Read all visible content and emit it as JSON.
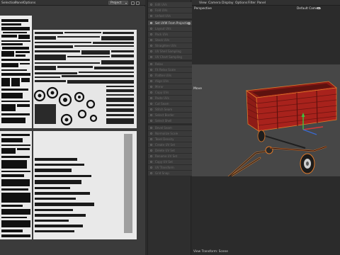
{
  "uv_editor": {
    "menus": [
      "Selection",
      "Panel",
      "Options"
    ],
    "dropdown_value": "Project"
  },
  "mid_panel": {
    "items": [
      {
        "label": "Edit UVs"
      },
      {
        "label": "Fold UVs"
      },
      {
        "label": "Unfold UVs"
      },
      {
        "label": "Set UVW From Projection",
        "active": true
      },
      {
        "label": "Layout UVs"
      },
      {
        "label": "Pack UVs"
      },
      {
        "label": "Stack UVs"
      },
      {
        "label": "Straighten UVs"
      },
      {
        "label": "UV Shell Sampling"
      },
      {
        "label": "UV Chart Sampling"
      },
      {
        "label": "Relax"
      },
      {
        "label": "Fit Relax Scale"
      },
      {
        "label": "Flatten UVs"
      },
      {
        "label": "Align UVs"
      },
      {
        "label": "Mirror"
      },
      {
        "label": "Copy UVs"
      },
      {
        "label": "Paste UVs"
      },
      {
        "label": "Cut Seam"
      },
      {
        "label": "Stitch Seam"
      },
      {
        "label": "Select Border"
      },
      {
        "label": "Select Shell"
      },
      {
        "label": "Bevel Seam"
      },
      {
        "label": "Normalize Scale"
      },
      {
        "label": "Texel Density"
      },
      {
        "label": "Create UV Set"
      },
      {
        "label": "Delete UV Set"
      },
      {
        "label": "Rename UV Set"
      },
      {
        "label": "Copy UV Set"
      },
      {
        "label": "UV Transform"
      },
      {
        "label": "Grid Snap"
      },
      {
        "label": "Pin UVs"
      },
      {
        "label": "Unpin UVs"
      },
      {
        "label": "Lock"
      },
      {
        "label": "Unlock"
      },
      {
        "label": "Snap"
      }
    ]
  },
  "viewport": {
    "menus": [
      "View",
      "Camera",
      "Display",
      "Options",
      "Filter",
      "Panel"
    ],
    "name": "Perspective",
    "camera": "Default Camera",
    "tool_label": "Move",
    "status": "View Transform: Scene"
  },
  "colors": {
    "trailer_body": "#a8221c",
    "trailer_dark": "#6e1410",
    "selection_outline": "#e07a2a",
    "uv_tile": "#e9e9e9",
    "viewport_bg": "#474747"
  }
}
